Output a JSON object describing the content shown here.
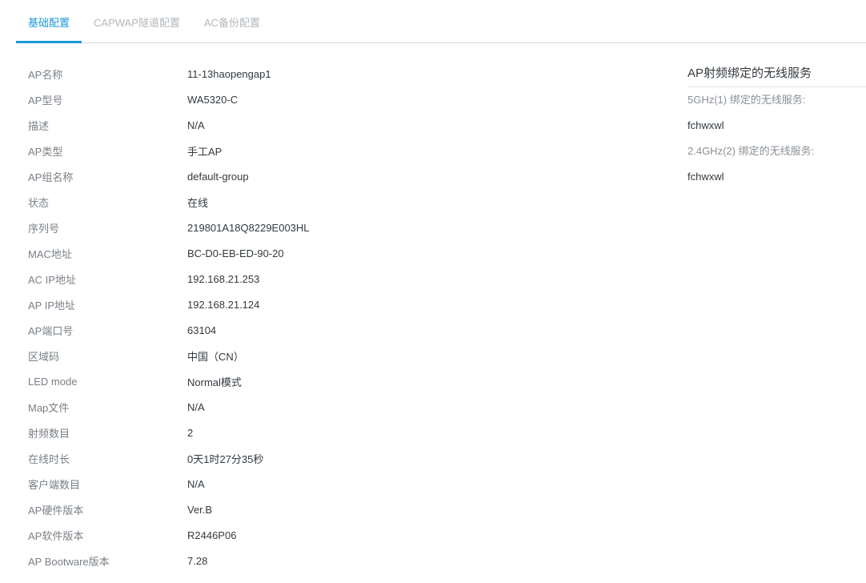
{
  "tabs": [
    {
      "label": "基础配置",
      "active": true
    },
    {
      "label": "CAPWAP隧道配置",
      "active": false
    },
    {
      "label": "AC备份配置",
      "active": false
    }
  ],
  "info": [
    {
      "label": "AP名称",
      "value": "11-13haopengap1"
    },
    {
      "label": "AP型号",
      "value": "WA5320-C"
    },
    {
      "label": "描述",
      "value": "N/A"
    },
    {
      "label": "AP类型",
      "value": "手工AP"
    },
    {
      "label": "AP组名称",
      "value": "default-group"
    },
    {
      "label": "状态",
      "value": "在线"
    },
    {
      "label": "序列号",
      "value": "219801A18Q8229E003HL"
    },
    {
      "label": "MAC地址",
      "value": "BC-D0-EB-ED-90-20"
    },
    {
      "label": "AC IP地址",
      "value": "192.168.21.253"
    },
    {
      "label": "AP IP地址",
      "value": "192.168.21.124"
    },
    {
      "label": "AP端口号",
      "value": "63104"
    },
    {
      "label": "区域码",
      "value": "中国（CN）"
    },
    {
      "label": "LED mode",
      "value": "Normal模式"
    },
    {
      "label": "Map文件",
      "value": "N/A"
    },
    {
      "label": "射频数目",
      "value": "2"
    },
    {
      "label": "在线时长",
      "value": "0天1时27分35秒"
    },
    {
      "label": "客户端数目",
      "value": "N/A"
    },
    {
      "label": "AP硬件版本",
      "value": "Ver.B"
    },
    {
      "label": "AP软件版本",
      "value": "R2446P06"
    },
    {
      "label": "AP Bootware版本",
      "value": "7.28"
    }
  ],
  "side": {
    "title": "AP射频绑定的无线服务",
    "radios": [
      {
        "label": "5GHz(1) 绑定的无线服务:",
        "service": "fchwxwl"
      },
      {
        "label": "2.4GHz(2) 绑定的无线服务:",
        "service": "fchwxwl"
      }
    ]
  },
  "colors": {
    "accent": "#1a9ad6",
    "tab_inactive": "#b3b8bd",
    "label": "#7a8087",
    "value": "#333a40"
  }
}
